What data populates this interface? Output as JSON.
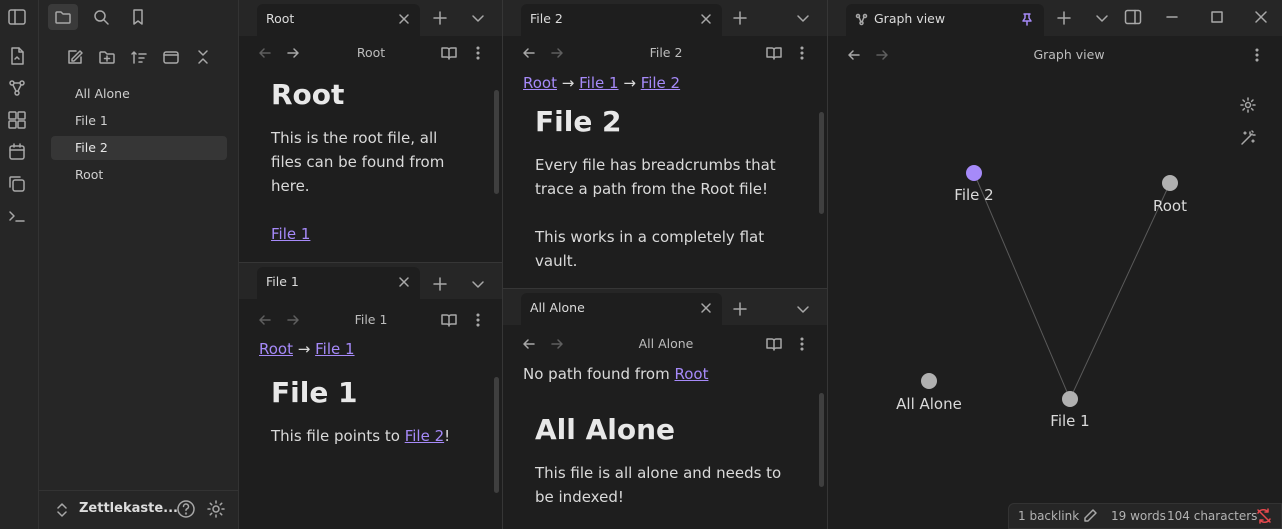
{
  "ribbon": {
    "icons": [
      "file-icon",
      "graph-icon",
      "canvas-icon",
      "calendar-icon",
      "copy-icon",
      "terminal-icon"
    ]
  },
  "sidebar": {
    "files": [
      "All Alone",
      "File 1",
      "File 2",
      "Root"
    ],
    "active_file": "File 2",
    "vault_name": "Zettlekaste..."
  },
  "panes": {
    "root": {
      "tab": "Root",
      "title": "Root",
      "heading": "Root",
      "body_line1": "This is the root file, all",
      "body_line2": "files can be found from",
      "body_line3": "here.",
      "link": "File 1"
    },
    "file1": {
      "tab": "File 1",
      "title": "File 1",
      "crumb_root": "Root",
      "crumb_arrow": "→",
      "crumb_file1": "File 1",
      "heading": "File 1",
      "body_prefix": "This file points to ",
      "body_link": "File 2",
      "body_suffix": "!"
    },
    "file2": {
      "tab": "File 2",
      "title": "File 2",
      "crumb_root": "Root",
      "crumb_arrow1": "→",
      "crumb_file1": "File 1",
      "crumb_arrow2": "→",
      "crumb_file2": "File 2",
      "heading": "File 2",
      "body_line1": "Every file has breadcrumbs that",
      "body_line2": "trace a path from the Root file!",
      "body_line3": "This works in a completely flat",
      "body_line4": "vault."
    },
    "allalone": {
      "tab": "All Alone",
      "title": "All Alone",
      "crumb_prefix": "No path found from ",
      "crumb_link": "Root",
      "heading": "All Alone",
      "body_line1": "This file is all alone and needs to",
      "body_line2": "be indexed!"
    },
    "graph": {
      "tab": "Graph view",
      "title": "Graph view",
      "nodes": [
        {
          "label": "File 2",
          "color": "#a68af9",
          "active": true
        },
        {
          "label": "Root",
          "color": "#b0b0b0"
        },
        {
          "label": "All Alone",
          "color": "#b0b0b0"
        },
        {
          "label": "File 1",
          "color": "#b0b0b0"
        }
      ],
      "edges": [
        [
          "File 2",
          "File 1"
        ],
        [
          "Root",
          "File 1"
        ]
      ]
    }
  },
  "status": {
    "backlinks": "1 backlink",
    "words": "19 words",
    "characters": "104 characters"
  },
  "colors": {
    "accent": "#a68af9",
    "background": "#1e1e1e",
    "chrome": "#262626",
    "sync_error": "#e5484d"
  }
}
